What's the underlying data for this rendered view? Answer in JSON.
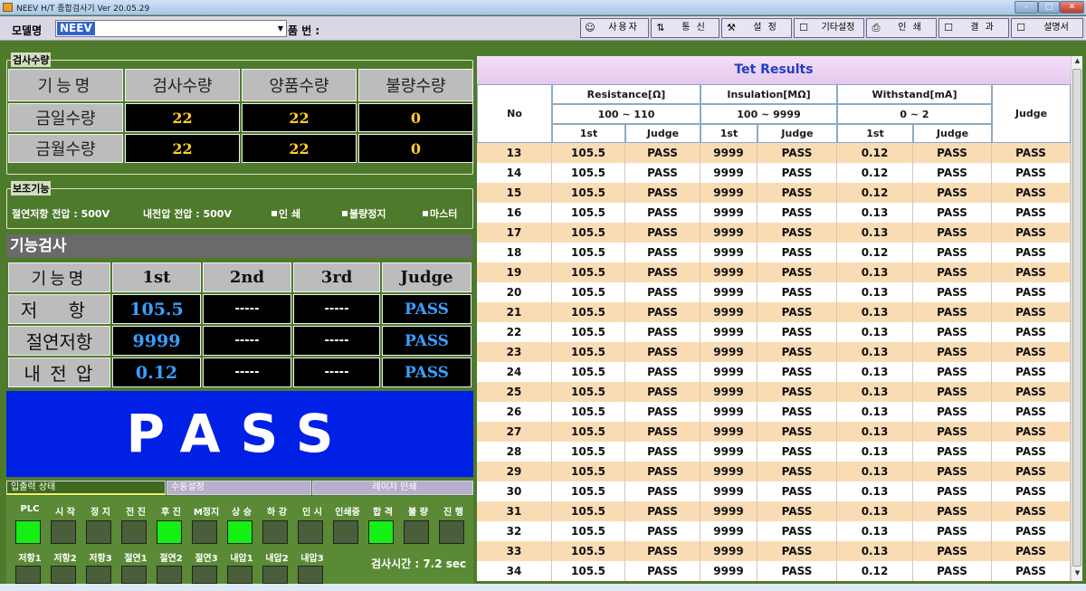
{
  "window": {
    "title": "NEEV H/T 종합검사기 Ver 20.05.29",
    "min": "–",
    "max": "□",
    "close": "✕"
  },
  "toolbar": {
    "model_label": "모델명",
    "model_value": "NEEV",
    "partno_label": "품 번 :",
    "buttons": [
      {
        "label": "사용자",
        "icon": "user-icon"
      },
      {
        "label": "통 신",
        "icon": "comm-icon"
      },
      {
        "label": "설 정",
        "icon": "tools-icon"
      },
      {
        "label": "기타설정",
        "icon": "checkbox-icon"
      },
      {
        "label": "인 쇄",
        "icon": "printer-icon"
      },
      {
        "label": "결 과",
        "icon": "results-icon"
      },
      {
        "label": "설명서",
        "icon": "manual-icon"
      }
    ]
  },
  "count": {
    "group_title": "검사수량",
    "headers": [
      "기능명",
      "검사수량",
      "양품수량",
      "불량수량"
    ],
    "rows": [
      {
        "label": "금일수량",
        "values": [
          "22",
          "22",
          "0"
        ]
      },
      {
        "label": "금월수량",
        "values": [
          "22",
          "22",
          "0"
        ]
      }
    ]
  },
  "aux": {
    "group_title": "보조기능",
    "insulation_voltage": "절연저항 전압 : 500V",
    "withstand_voltage": "내전압 전압 : 500V",
    "options": [
      "인 쇄",
      "불량정지",
      "마스터"
    ]
  },
  "func": {
    "title": "기능검사",
    "headers": [
      "기능명",
      "1st",
      "2nd",
      "3rd",
      "Judge"
    ],
    "rows": [
      {
        "label": "저 항",
        "v1": "105.5",
        "v2": "-----",
        "v3": "-----",
        "judge": "PASS"
      },
      {
        "label": "절연저항",
        "v1": "9999",
        "v2": "-----",
        "v3": "-----",
        "judge": "PASS"
      },
      {
        "label": "내 전 압",
        "v1": "0.12",
        "v2": "-----",
        "v3": "-----",
        "judge": "PASS"
      }
    ],
    "result": "PASS"
  },
  "io": {
    "tabs": [
      "입출력 상태",
      "수동설정",
      "레이저 인쇄"
    ],
    "row1": [
      {
        "label": "PLC",
        "on": true
      },
      {
        "label": "시 작",
        "on": false
      },
      {
        "label": "정 지",
        "on": false
      },
      {
        "label": "전 진",
        "on": false
      },
      {
        "label": "후 진",
        "on": true
      },
      {
        "label": "M정지",
        "on": false
      },
      {
        "label": "상 승",
        "on": true
      },
      {
        "label": "하 강",
        "on": false
      },
      {
        "label": "인 시",
        "on": false
      },
      {
        "label": "인쇄중",
        "on": false
      },
      {
        "label": "합 격",
        "on": true
      },
      {
        "label": "불 량",
        "on": false
      },
      {
        "label": "진 행",
        "on": false
      }
    ],
    "row2": [
      "저항1",
      "저항2",
      "저항3",
      "절연1",
      "절연2",
      "절연3",
      "내압1",
      "내압2",
      "내압3"
    ],
    "inspection_time": "검사시간 : 7.2 sec"
  },
  "results": {
    "title": "Tet Results",
    "col_no": "No",
    "col_judge": "Judge",
    "groups": [
      {
        "name": "Resistance[Ω]",
        "range": "100 ~ 110"
      },
      {
        "name": "Insulation[MΩ]",
        "range": "100 ~ 9999"
      },
      {
        "name": "Withstand[mA]",
        "range": "0 ~ 2"
      }
    ],
    "sub_first": "1st",
    "sub_judge": "Judge",
    "rows": [
      [
        "13",
        "105.5",
        "PASS",
        "9999",
        "PASS",
        "0.12",
        "PASS",
        "PASS"
      ],
      [
        "14",
        "105.5",
        "PASS",
        "9999",
        "PASS",
        "0.12",
        "PASS",
        "PASS"
      ],
      [
        "15",
        "105.5",
        "PASS",
        "9999",
        "PASS",
        "0.12",
        "PASS",
        "PASS"
      ],
      [
        "16",
        "105.5",
        "PASS",
        "9999",
        "PASS",
        "0.13",
        "PASS",
        "PASS"
      ],
      [
        "17",
        "105.5",
        "PASS",
        "9999",
        "PASS",
        "0.13",
        "PASS",
        "PASS"
      ],
      [
        "18",
        "105.5",
        "PASS",
        "9999",
        "PASS",
        "0.12",
        "PASS",
        "PASS"
      ],
      [
        "19",
        "105.5",
        "PASS",
        "9999",
        "PASS",
        "0.13",
        "PASS",
        "PASS"
      ],
      [
        "20",
        "105.5",
        "PASS",
        "9999",
        "PASS",
        "0.13",
        "PASS",
        "PASS"
      ],
      [
        "21",
        "105.5",
        "PASS",
        "9999",
        "PASS",
        "0.13",
        "PASS",
        "PASS"
      ],
      [
        "22",
        "105.5",
        "PASS",
        "9999",
        "PASS",
        "0.13",
        "PASS",
        "PASS"
      ],
      [
        "23",
        "105.5",
        "PASS",
        "9999",
        "PASS",
        "0.13",
        "PASS",
        "PASS"
      ],
      [
        "24",
        "105.5",
        "PASS",
        "9999",
        "PASS",
        "0.13",
        "PASS",
        "PASS"
      ],
      [
        "25",
        "105.5",
        "PASS",
        "9999",
        "PASS",
        "0.13",
        "PASS",
        "PASS"
      ],
      [
        "26",
        "105.5",
        "PASS",
        "9999",
        "PASS",
        "0.13",
        "PASS",
        "PASS"
      ],
      [
        "27",
        "105.5",
        "PASS",
        "9999",
        "PASS",
        "0.13",
        "PASS",
        "PASS"
      ],
      [
        "28",
        "105.5",
        "PASS",
        "9999",
        "PASS",
        "0.13",
        "PASS",
        "PASS"
      ],
      [
        "29",
        "105.5",
        "PASS",
        "9999",
        "PASS",
        "0.13",
        "PASS",
        "PASS"
      ],
      [
        "30",
        "105.5",
        "PASS",
        "9999",
        "PASS",
        "0.13",
        "PASS",
        "PASS"
      ],
      [
        "31",
        "105.5",
        "PASS",
        "9999",
        "PASS",
        "0.13",
        "PASS",
        "PASS"
      ],
      [
        "32",
        "105.5",
        "PASS",
        "9999",
        "PASS",
        "0.13",
        "PASS",
        "PASS"
      ],
      [
        "33",
        "105.5",
        "PASS",
        "9999",
        "PASS",
        "0.13",
        "PASS",
        "PASS"
      ],
      [
        "34",
        "105.5",
        "PASS",
        "9999",
        "PASS",
        "0.12",
        "PASS",
        "PASS"
      ]
    ]
  }
}
